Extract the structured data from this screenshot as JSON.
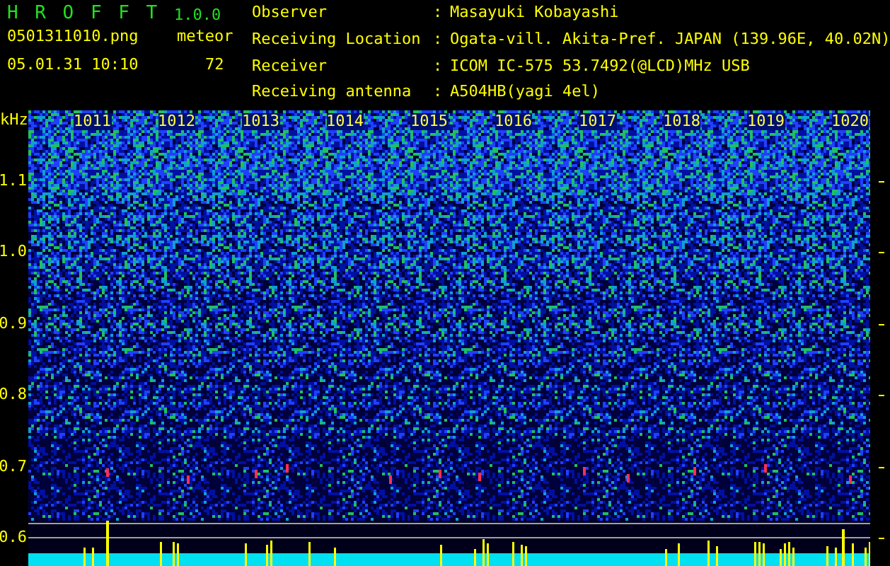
{
  "header": {
    "title": "H R O F F T",
    "version": "1.0.0",
    "filename": "0501311010.png",
    "datetime": "05.01.31 10:10",
    "meteor_label": "meteor",
    "meteor_count": "72"
  },
  "info": [
    {
      "label": "Observer",
      "separator": ":",
      "value": "Masayuki Kobayashi"
    },
    {
      "label": "Receiving Location",
      "separator": ":",
      "value": "Ogata-vill. Akita-Pref. JAPAN (139.96E, 40.02N)"
    },
    {
      "label": "Receiver",
      "separator": ":",
      "value": "ICOM IC-575 53.7492(@LCD)MHz USB"
    },
    {
      "label": "Receiving antenna",
      "separator": ":",
      "value": "A504HB(yagi 4el)"
    }
  ],
  "spectrogram": {
    "unit": "kHz",
    "y_ticks": [
      "1.1",
      "1.0",
      "0.9",
      "0.8",
      "0.7",
      "0.6"
    ],
    "time_labels": [
      "1011",
      "1012",
      "1013",
      "1014",
      "1015",
      "1016",
      "1017",
      "1018",
      "1019",
      "1020"
    ]
  }
}
